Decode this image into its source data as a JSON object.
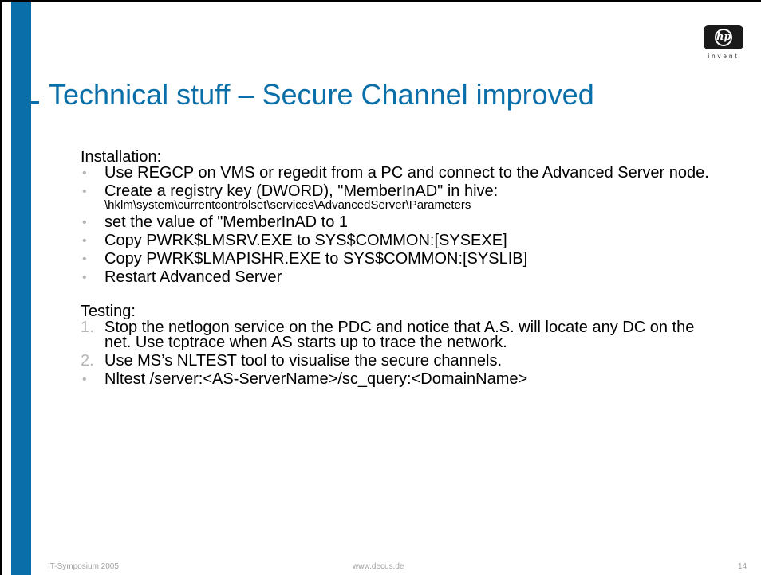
{
  "slide": {
    "title": "Technical stuff – Secure Channel improved",
    "installation_heading": "Installation:",
    "installation_items": [
      "Use REGCP on VMS or regedit from a PC and connect to the Advanced Server node.",
      "Create a registry key (DWORD), \"MemberInAD\" in hive:",
      "set the value of \"MemberInAD  to 1",
      "Copy PWRK$LMSRV.EXE to SYS$COMMON:[SYSEXE]",
      "Copy PWRK$LMAPISHR.EXE to SYS$COMMON:[SYSLIB]",
      "Restart Advanced Server"
    ],
    "registry_path": "\\hklm\\system\\currentcontrolset\\services\\AdvancedServer\\Parameters",
    "testing_heading": "Testing:",
    "testing_items": [
      {
        "marker": "1.",
        "text": "Stop the netlogon service on the PDC and notice that A.S. will locate any DC on the net. Use tcptrace when AS starts up to trace the network."
      },
      {
        "marker": "2.",
        "text": "Use MS’s NLTEST tool to visualise the secure channels."
      },
      {
        "marker": "•",
        "text": "Nltest /server:<AS-ServerName>/sc_query:<DomainName>"
      }
    ],
    "bullet": "•"
  },
  "logo": {
    "mark": "hp",
    "tagline": "invent"
  },
  "footer": {
    "left": "IT-Symposium 2005",
    "center": "www.decus.de",
    "page_number": "14"
  },
  "colors": {
    "accent": "#0a6fa8",
    "bullet": "#b5b5b5",
    "footer": "#a0a0a0"
  }
}
